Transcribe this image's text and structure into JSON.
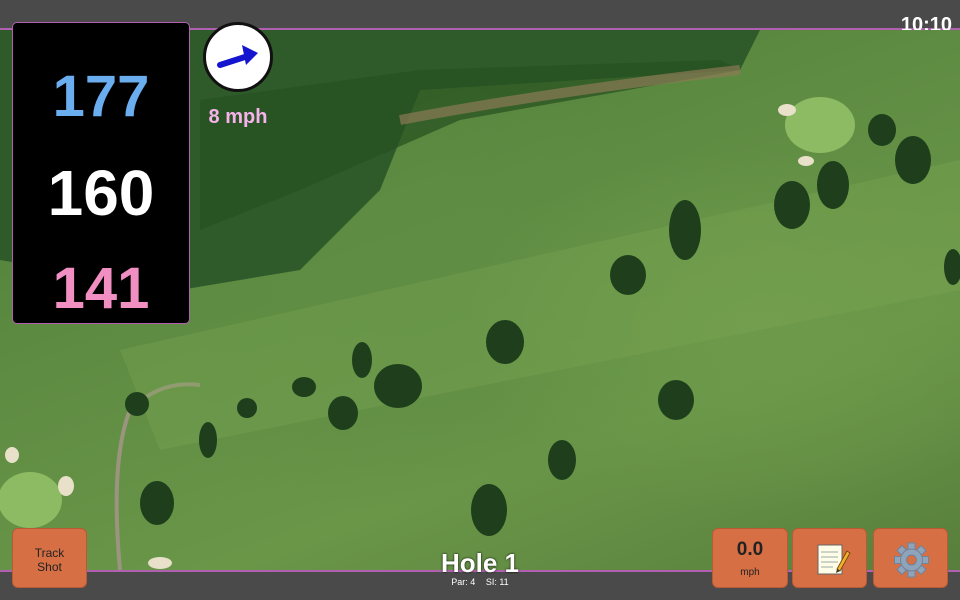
{
  "status": {
    "time": "10:10"
  },
  "distances": {
    "back": "177",
    "middle": "160",
    "front": "141"
  },
  "wind": {
    "speed": "8 mph",
    "icon": "wind-arrow-icon"
  },
  "hole": {
    "title": "Hole 1",
    "par": "Par: 4",
    "si": "SI: 11"
  },
  "buttons": {
    "track_shot": [
      "Track",
      "Shot"
    ],
    "speed_value": "0.0",
    "speed_unit": "mph",
    "notes_icon": "notepad-icon",
    "settings_icon": "gear-icon"
  },
  "colors": {
    "accent": "#b15fb0",
    "back": "#6aaef0",
    "front": "#f28fc2",
    "button": "#d76f45"
  }
}
